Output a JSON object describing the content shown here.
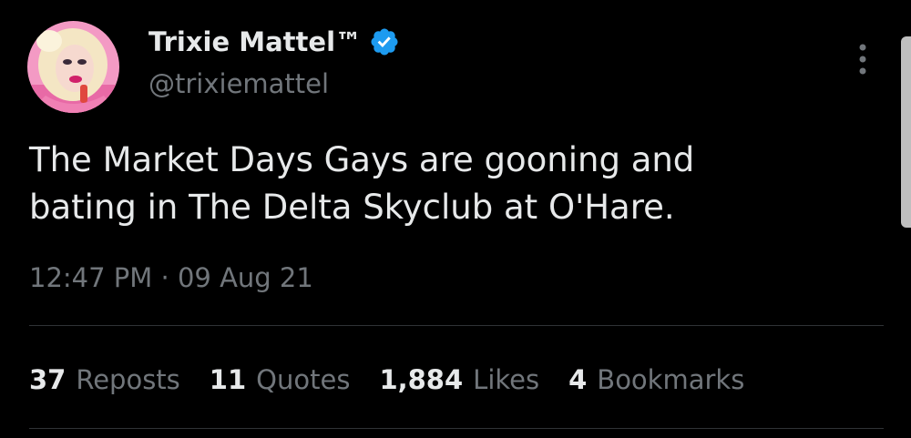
{
  "author": {
    "display_name": "Trixie Mattel™",
    "handle": "@trixiemattel",
    "avatar_icon": "profile-avatar",
    "verified_icon": "verified-badge-icon",
    "verified_color": "#1d9bf0"
  },
  "menu": {
    "more_icon": "more-vertical-icon"
  },
  "tweet": {
    "text_line_1": "The Market Days Gays are gooning and",
    "text_line_2": "bating in The Delta Skyclub at O'Hare.",
    "timestamp": "12:47 PM · 09 Aug 21"
  },
  "stats": {
    "reposts": {
      "count": "37",
      "label": "Reposts"
    },
    "quotes": {
      "count": "11",
      "label": "Quotes"
    },
    "likes": {
      "count": "1,884",
      "label": "Likes"
    },
    "bookmarks": {
      "count": "4",
      "label": "Bookmarks"
    }
  },
  "colors": {
    "background": "#000000",
    "primary_text": "#e7e9ea",
    "secondary_text": "#71767b",
    "divider": "#2f3336",
    "accent": "#1d9bf0"
  }
}
